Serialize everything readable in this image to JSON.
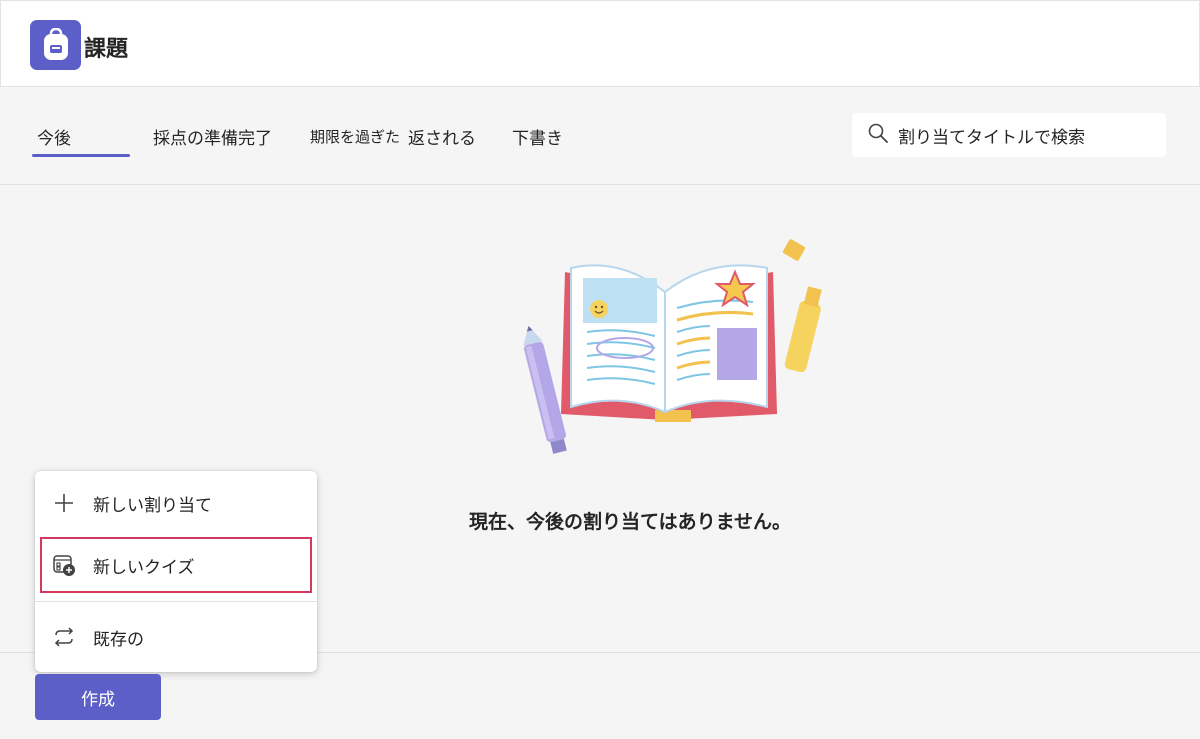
{
  "app": {
    "title": "課題",
    "icon": "backpack-icon",
    "accent": "#5b5fc7"
  },
  "tabs": [
    {
      "label": "今後",
      "active": true
    },
    {
      "label": "採点の準備完了",
      "active": false
    },
    {
      "label": "期限を過ぎた",
      "active": false
    },
    {
      "label": "返される",
      "active": false
    },
    {
      "label": "下書き",
      "active": false
    }
  ],
  "search": {
    "placeholder": "割り当てタイトルで検索",
    "icon": "search-icon"
  },
  "empty_state": {
    "message": "現在、今後の割り当てはありません。",
    "illustration": "open-book-illustration"
  },
  "create_menu": {
    "items": [
      {
        "label": "新しい割り当て",
        "icon": "plus-icon"
      },
      {
        "label": "新しいクイズ",
        "icon": "quiz-icon",
        "highlighted": true,
        "highlight_color": "#d13a5c"
      },
      {
        "label": "既存の",
        "icon": "reuse-icon"
      }
    ]
  },
  "create_button": {
    "label": "作成"
  }
}
